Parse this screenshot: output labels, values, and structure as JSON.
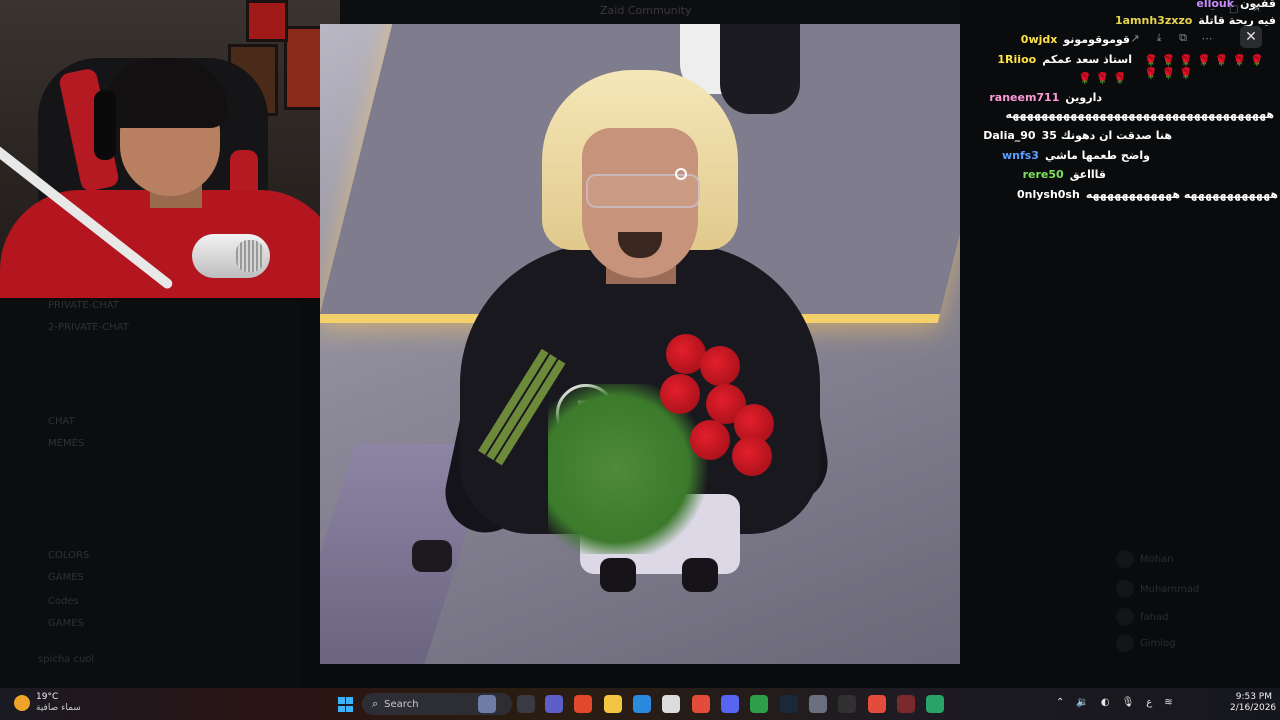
{
  "background": {
    "window_title": "Zaid Community",
    "channels": [
      "PRIVATE-CHAT",
      "2-PRIVATE-CHAT",
      "CHAT",
      "MEMES",
      "COLORS",
      "GAMES",
      "Codes",
      "GAMES"
    ],
    "members": [
      "Mohan",
      "Muhammad",
      "fahad",
      "Gimlog"
    ],
    "status_user": "spicha cuol"
  },
  "chat": {
    "messages": [
      {
        "user": "ellouk",
        "user_color": "#c98cff",
        "text": "قفبون"
      },
      {
        "user": "1amnh3zxzo",
        "user_color": "#e8d44d",
        "text": "فيه ريحة قاتلة"
      },
      {
        "user": "0wjdx",
        "user_color": "#ffe14a",
        "text": "قوموقومونو"
      },
      {
        "user": "1Riioo",
        "user_color": "#ffe14a",
        "text": "استاذ سعد عمكم"
      },
      {
        "user": "raneem711",
        "user_color": "#ff9ad8",
        "text": "داروين"
      },
      {
        "user": "Dalia_90",
        "user_color": "#ffffff",
        "text": "هنا صدقت ان دهونك 35"
      },
      {
        "user": "wnfs3",
        "user_color": "#5aa0ff",
        "text": "واضح طعمها ماشي"
      },
      {
        "user": "rere50",
        "user_color": "#7fe35a",
        "text": "قاااعق"
      },
      {
        "user": "0nlysh0sh",
        "user_color": "#ffffff",
        "text": "ههههههههههههه ههههههههههههه"
      }
    ],
    "wrap_line_1": "ههههههههههههههههههههههههههههههههههههه",
    "emote_row_1": "🌹🌹🌹🌹🌹🌹🌹🌹🌹🌹",
    "emote_row_2": "🌹🌹🌹"
  },
  "popup": {
    "icons": [
      "share-icon",
      "download-icon",
      "open-external-icon",
      "more-icon"
    ],
    "close_label": "✕"
  },
  "window_controls": [
    "–",
    "□",
    "✕"
  ],
  "taskbar": {
    "weather_temp": "19°C",
    "weather_desc": "سماء صافية",
    "search_placeholder": "Search",
    "tray_lang": "ع",
    "time": "9:53 PM",
    "date": "2/16/2026"
  }
}
